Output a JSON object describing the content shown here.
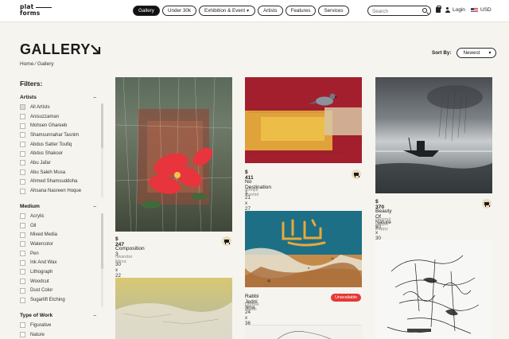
{
  "brand": {
    "line1": "plat",
    "line2": "forms"
  },
  "nav": {
    "gallery": "Gallery",
    "under30k": "Under 30k",
    "exhibition": "Exhibition & Event",
    "artists": "Artists",
    "features": "Features",
    "services": "Services"
  },
  "search": {
    "placeholder": "Search"
  },
  "header": {
    "login": "Login",
    "currency": "USD"
  },
  "page": {
    "title": "GALLERY",
    "breadcrumb": "Home ⁄ Gallery"
  },
  "sort": {
    "label": "Sort By:",
    "value": "Newest"
  },
  "filters": {
    "title": "Filters:",
    "artists": {
      "label": "Artists",
      "items": [
        "All Artists",
        "Anisuzzaman",
        "Mohsen Ghareeb",
        "Shamsunnahar Tasnim",
        "Abdus Satter Toufiq",
        "Abdus Shakoor",
        "Abu Jafar",
        "Abu Saleh Musa",
        "Ahmed Shamsuddoha",
        "Ahsana Nasreen Hoque"
      ]
    },
    "medium": {
      "label": "Medium",
      "items": [
        "Acrylic",
        "Oil",
        "Mixed Media",
        "Watercolor",
        "Pen",
        "Ink And Wax",
        "Lithograph",
        "Woodcut",
        "Dust Color",
        "Sugarlift Etching"
      ]
    },
    "type": {
      "label": "Type of Work",
      "items": [
        "Figurative",
        "Nature"
      ]
    }
  },
  "artworks": [
    {
      "price": "$ 247",
      "title": "Composition 3",
      "artist": "Iskandar Mirza",
      "size": "30 x 22 in"
    },
    {
      "price": "$ 411",
      "title": "No Destination 1",
      "artist": "Monjur Rashid",
      "size": "21 x 27 in"
    },
    {
      "price": "$ 370",
      "title": "Beauty Of Nature I",
      "artist": "Nazmul Haque Bappy",
      "size": "30 x 30 in"
    },
    {
      "title": "Rabbi Jedni Ilma",
      "artist": "Ummie Habib",
      "size": "24 x 36 in",
      "status": "Unavailable"
    }
  ],
  "colors": {
    "accent": "#111111",
    "background": "#f6f4ef",
    "unavailable": "#e53935",
    "cart": "#e9dcc0"
  }
}
